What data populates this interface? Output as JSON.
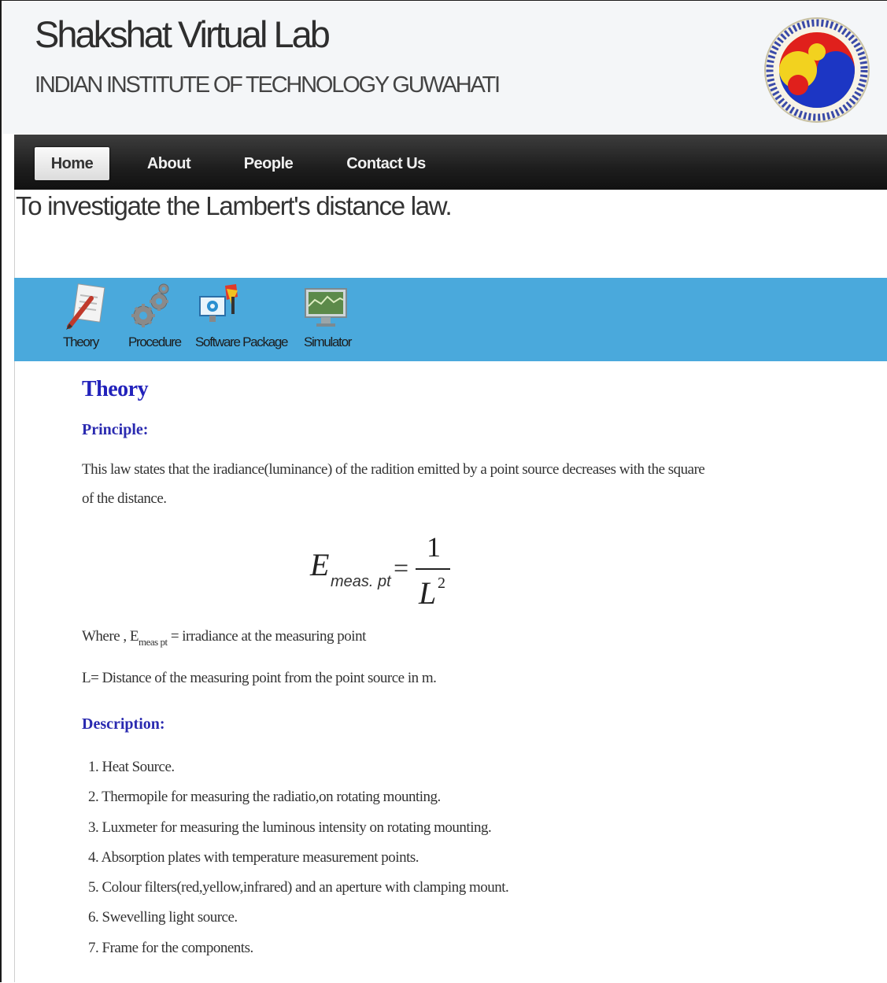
{
  "header": {
    "site_title": "Shakshat Virtual Lab",
    "institute": "INDIAN INSTITUTE OF TECHNOLOGY GUWAHATI",
    "logo_icon": "iitg-logo-icon"
  },
  "nav": {
    "items": [
      {
        "label": "Home",
        "active": true
      },
      {
        "label": "About"
      },
      {
        "label": "People"
      },
      {
        "label": "Contact Us"
      }
    ]
  },
  "experiment": {
    "title": "To investigate the Lambert's distance law."
  },
  "toolbar": {
    "items": [
      {
        "label": "Theory",
        "icon": "theory-pen-paper-icon"
      },
      {
        "label": "Procedure",
        "icon": "procedure-gears-icon"
      },
      {
        "label": "Software Package",
        "icon": "software-package-icon"
      },
      {
        "label": "Simulator",
        "icon": "simulator-monitor-icon"
      }
    ],
    "background_color": "#4aa9dc"
  },
  "theory": {
    "heading": "Theory",
    "principle_heading": "Principle:",
    "principle_text": "This law states that the iradiance(luminance) of the radition emitted by a point source decreases with the square of the distance.",
    "equation": {
      "lhs_symbol": "E",
      "lhs_subscript": "meas. pt",
      "equals": "=",
      "numerator": "1",
      "denominator_symbol": "L",
      "denominator_exponent": "2"
    },
    "where_prefix": "Where ,  E",
    "where_subscript": "meas pt",
    "where_definition": " = irradiance at the measuring point",
    "l_definition": "L= Distance of the measuring point from the point source in m.",
    "description_heading": "Description:",
    "description_items": [
      "1. Heat Source.",
      "2. Thermopile for measuring the radiatio,on rotating mounting.",
      "3. Luxmeter for measuring the luminous intensity on rotating mounting.",
      "4. Absorption plates with temperature measurement points.",
      "5. Colour filters(red,yellow,infrared) and an aperture with clamping mount.",
      "6. Swevelling light source.",
      "7. Frame for the components."
    ]
  },
  "colors": {
    "nav_bg": "#1e1e1e",
    "heading_blue": "#2222bb",
    "toolbar_blue": "#4aa9dc"
  }
}
